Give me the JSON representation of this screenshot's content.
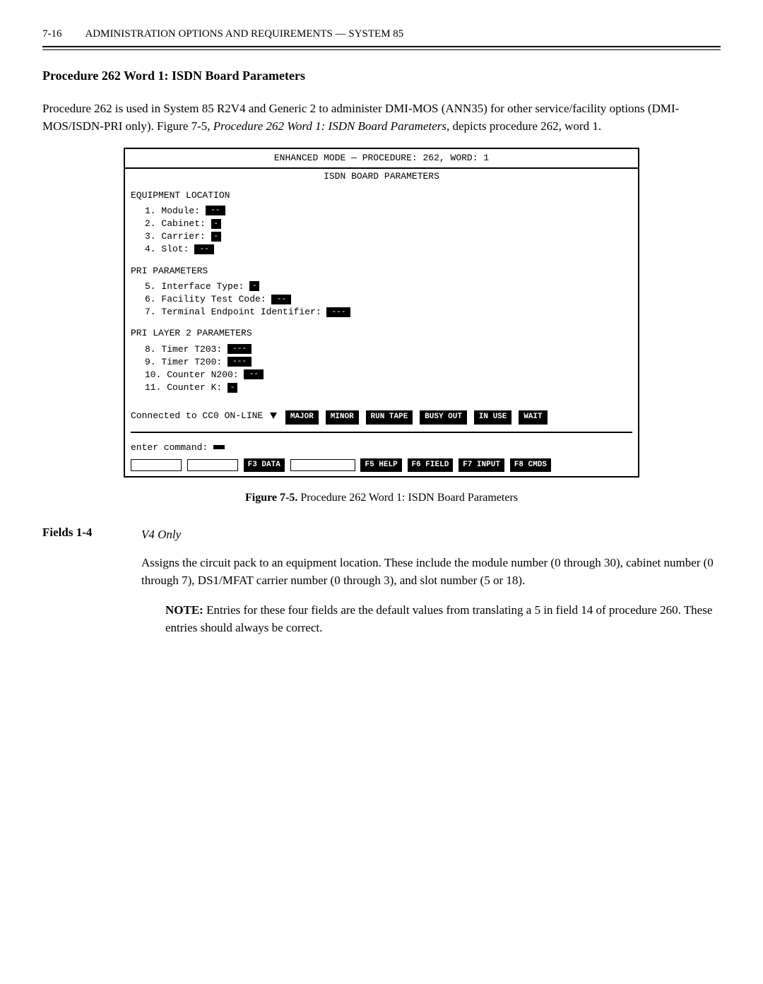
{
  "header": {
    "page": "7-16",
    "title": "ADMINISTRATION OPTIONS AND REQUIREMENTS — SYSTEM 85"
  },
  "section_title": "Procedure 262 Word 1: ISDN Board Parameters",
  "intro_1": "Procedure 262 is used in System 85 R2V4 and Generic 2 to administer DMI-MOS (ANN35) for other service/facility options (DMI-MOS/ISDN-PRI only). Figure 7-5, ",
  "intro_italic": "Procedure 262 Word 1: ISDN Board Parameters,",
  "intro_2": " depicts procedure 262, word 1.",
  "terminal": {
    "mode_line": "ENHANCED MODE — PROCEDURE:  262, WORD:   1",
    "subtitle": "ISDN BOARD PARAMETERS",
    "equip_heading": "EQUIPMENT  LOCATION",
    "f1_label": "1.   Module:",
    "f1_val": "--",
    "f2_label": "2.  Cabinet:",
    "f2_val": "-",
    "f3_label": "3.  Carrier:",
    "f3_val": "-",
    "f4_label": "4.     Slot:",
    "f4_val": "--",
    "pri_heading": "PRI  PARAMETERS",
    "f5_label": "5.  Interface Type:",
    "f5_val": "-",
    "f6_label": "6.            Facility Test Code:",
    "f6_val": "--",
    "f7_label": "7.  Terminal Endpoint Identifier:",
    "f7_val": "---",
    "layer2_heading": "PRI LAYER 2 PARAMETERS",
    "f8_label": "8.    Timer T203:",
    "f8_val": "---",
    "f9_label": "9.    Timer T200:",
    "f9_val": "---",
    "f10_label": "10. Counter N200:",
    "f10_val": "--",
    "f11_label": "11.    Counter K:",
    "f11_val": "-",
    "conn_prefix": "Connected to CC0 ON-LINE ",
    "status": [
      "MAJOR",
      "MINOR",
      "RUN TAPE",
      "BUSY OUT",
      "IN USE",
      "WAIT"
    ],
    "cmd_label": "enter command: ",
    "fkeys": {
      "f3": "F3 DATA",
      "f5": "F5 HELP",
      "f6": "F6 FIELD",
      "f7": "F7 INPUT",
      "f8": "F8 CMDS"
    }
  },
  "figure_caption_b": "Figure 7-5.",
  "figure_caption_rest": " Procedure 262 Word 1: ISDN Board Parameters",
  "fields_label": "Fields 1-4",
  "fields_ital": "V4 Only",
  "fields_p1": "Assigns the circuit pack to an equipment location. These include the module number (0 through 30), cabinet number (0 through 7), DS1/MFAT carrier number (0 through 3), and slot number (5 or 18).",
  "note_b": "NOTE:",
  "note_text": " Entries for these four fields are the default values from translating a 5 in field 14 of procedure 260. These entries should always be correct."
}
